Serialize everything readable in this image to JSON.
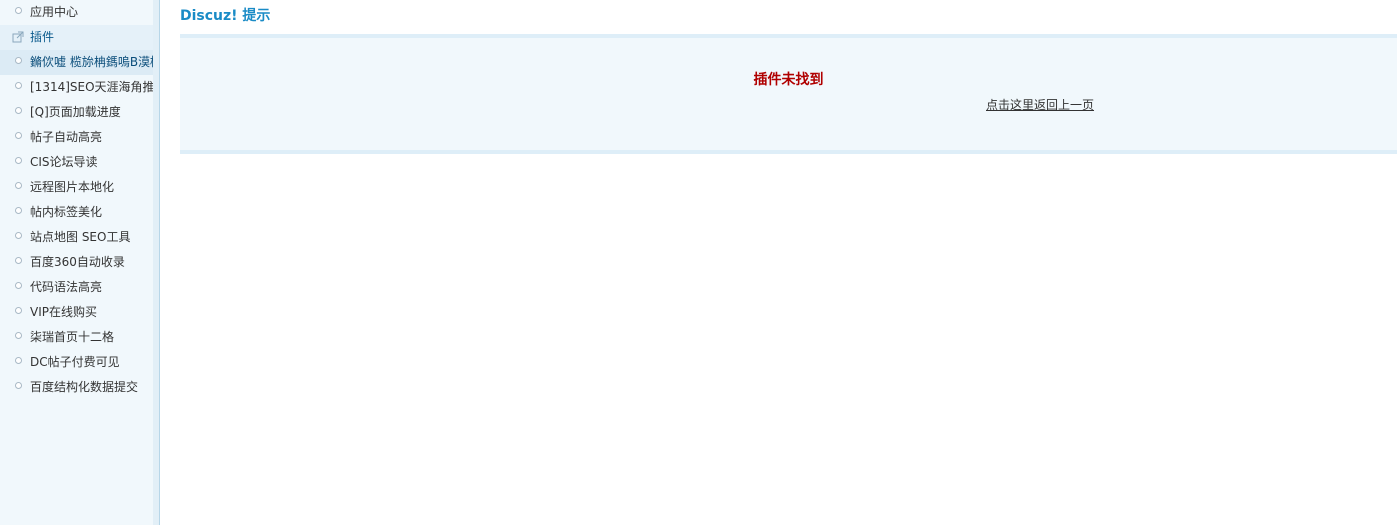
{
  "sidebar": {
    "items": [
      {
        "label": "应用中心",
        "kind": "item"
      },
      {
        "label": "插件",
        "kind": "section"
      },
      {
        "label": "鏅佽嘘 榄旀柟鎷嗚В漠樱",
        "kind": "active"
      },
      {
        "label": "[1314]SEO天涯海角推",
        "kind": "item"
      },
      {
        "label": "[Q]页面加载进度",
        "kind": "item"
      },
      {
        "label": "帖子自动高亮",
        "kind": "item"
      },
      {
        "label": "CIS论坛导读",
        "kind": "item"
      },
      {
        "label": "远程图片本地化",
        "kind": "item"
      },
      {
        "label": "帖内标签美化",
        "kind": "item"
      },
      {
        "label": "站点地图 SEO工具",
        "kind": "item"
      },
      {
        "label": "百度360自动收录",
        "kind": "item"
      },
      {
        "label": "代码语法高亮",
        "kind": "item"
      },
      {
        "label": "VIP在线购买",
        "kind": "item"
      },
      {
        "label": "柒瑞首页十二格",
        "kind": "item"
      },
      {
        "label": "DC帖子付费可见",
        "kind": "item"
      },
      {
        "label": "百度结构化数据提交",
        "kind": "item"
      }
    ]
  },
  "main": {
    "title": "Discuz! 提示",
    "message": "插件未找到",
    "back_link": "点击这里返回上一页"
  },
  "colors": {
    "title": "#1a8bc6",
    "message": "#b00000",
    "sidebar_bg": "#f1f8fc",
    "notice_bg": "#f1f8fc",
    "notice_border": "#deeef8"
  }
}
